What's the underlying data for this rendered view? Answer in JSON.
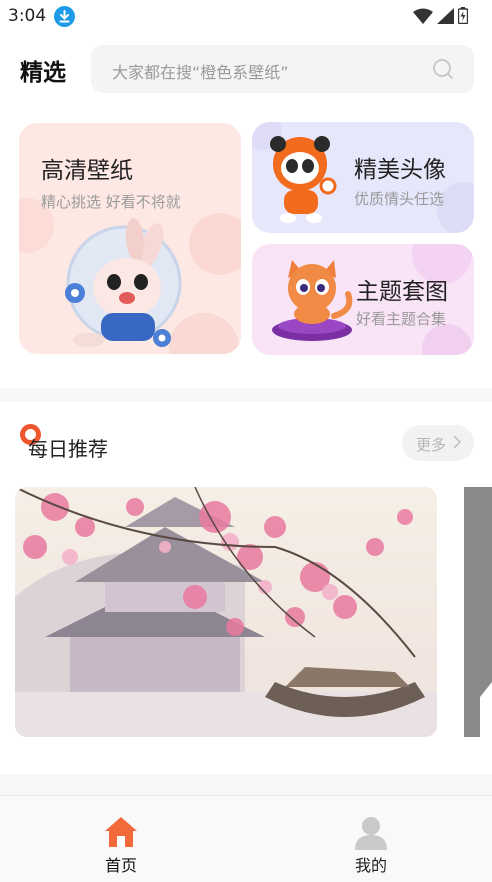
{
  "status_bar": {
    "time": "3:04"
  },
  "header": {
    "title": "精选",
    "search_placeholder": "大家都在搜“橙色系壁纸”"
  },
  "categories": [
    {
      "title": "高清壁纸",
      "subtitle": "精心挑选 好看不将就"
    },
    {
      "title": "精美头像",
      "subtitle": "优质情头任选"
    },
    {
      "title": "主题套图",
      "subtitle": "好看主题合集"
    }
  ],
  "daily": {
    "title": "每日推荐",
    "more_label": "更多"
  },
  "bottom_nav": [
    {
      "label": "首页",
      "active": true
    },
    {
      "label": "我的",
      "active": false
    }
  ],
  "colors": {
    "accent": "#f0562e",
    "download_badge": "#1e9be8",
    "hd_card": "#fde8e4",
    "avatar_card": "#e7e7fb",
    "theme_card": "#f8e3f7"
  }
}
